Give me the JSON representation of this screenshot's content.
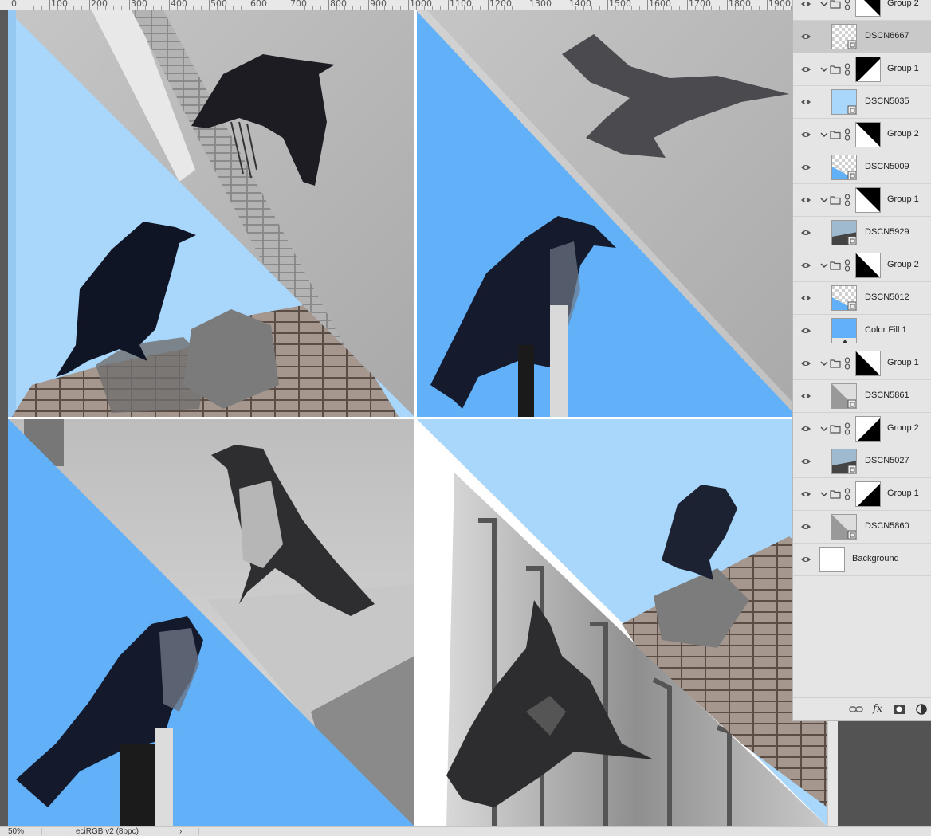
{
  "ruler": {
    "labels": [
      "0",
      "100",
      "200",
      "300",
      "400",
      "500",
      "600",
      "700",
      "800",
      "900",
      "1000",
      "1100",
      "1200",
      "1300",
      "1400",
      "1500",
      "1600",
      "1700",
      "1800",
      "1900"
    ]
  },
  "canvas": {
    "tiles": [
      {
        "name": "tile-top-left",
        "content": "crow standing on roof tiles against sky, crow flying over pavement"
      },
      {
        "name": "tile-top-right",
        "content": "hooded crow perched on post against sky, crow flying over pavement"
      },
      {
        "name": "tile-bottom-left",
        "content": "hooded crow on concrete ledge, hooded crow perched on post against sky"
      },
      {
        "name": "tile-bottom-right",
        "content": "crow on rooftop against sky, crow flying in front of building"
      }
    ],
    "colors": {
      "sky_light": "#a9d6fb",
      "sky_blue": "#62b1f8",
      "pavement": "#b8b8b8",
      "concrete": "#cfcfcf",
      "roof": "#9d8a80"
    }
  },
  "layers": [
    {
      "type": "group",
      "name": "Group 2",
      "mask": "top-right-black",
      "selected": false
    },
    {
      "type": "layer",
      "name": "DSCN6667",
      "thumb": "transparent",
      "selected": true
    },
    {
      "type": "group",
      "name": "Group 1",
      "mask": "bottom-right-white",
      "selected": false
    },
    {
      "type": "layer",
      "name": "DSCN5035",
      "thumb": "sky",
      "selected": false
    },
    {
      "type": "group",
      "name": "Group 2",
      "mask": "bottom-left-white",
      "selected": false
    },
    {
      "type": "layer",
      "name": "DSCN5009",
      "thumb": "transparent-sky",
      "selected": false
    },
    {
      "type": "group",
      "name": "Group 1",
      "mask": "bottom-left-white",
      "selected": false
    },
    {
      "type": "layer",
      "name": "DSCN5929",
      "thumb": "photo",
      "selected": false
    },
    {
      "type": "group",
      "name": "Group 2",
      "mask": "top-right-white",
      "selected": false
    },
    {
      "type": "layer",
      "name": "DSCN5012",
      "thumb": "transparent-sky",
      "selected": false
    },
    {
      "type": "fill",
      "name": "Color Fill 1",
      "thumb": "fill",
      "selected": false
    },
    {
      "type": "group",
      "name": "Group 1",
      "mask": "top-right-white",
      "selected": false
    },
    {
      "type": "layer",
      "name": "DSCN5861",
      "thumb": "photo-gray",
      "selected": false
    },
    {
      "type": "group",
      "name": "Group 2",
      "mask": "top-left-white",
      "selected": false
    },
    {
      "type": "layer",
      "name": "DSCN5027",
      "thumb": "photo",
      "selected": false
    },
    {
      "type": "group",
      "name": "Group 1",
      "mask": "top-left-white",
      "selected": false
    },
    {
      "type": "layer",
      "name": "DSCN5860",
      "thumb": "photo-gray",
      "selected": false
    },
    {
      "type": "background",
      "name": "Background",
      "thumb": "white",
      "selected": false
    }
  ],
  "panel_footer": {
    "icons": [
      "link-layers-icon",
      "fx-icon",
      "add-mask-icon",
      "adjustment-layer-icon"
    ],
    "fx_label": "fx"
  },
  "status": {
    "zoom": "50%",
    "profile": "eciRGB v2 (8bpc)",
    "arrow": "›"
  }
}
